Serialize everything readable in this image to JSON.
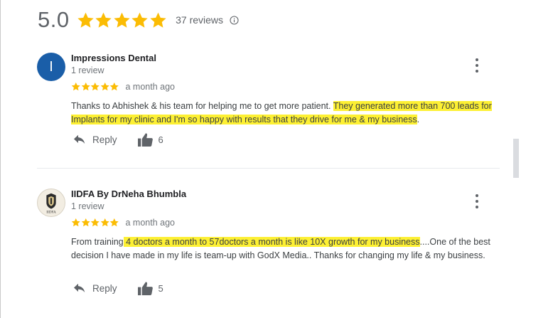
{
  "summary": {
    "rating": "5.0",
    "stars": 5,
    "review_count": "37 reviews",
    "star_color": "#fbbc04"
  },
  "reviews": [
    {
      "reviewer": "Impressions Dental",
      "avatar_letter": "I",
      "avatar_color": "#1a5ea8",
      "meta": "1 review",
      "stars": 5,
      "time": "a month ago",
      "text_plain": "Thanks to Abhishek & his team for helping me to get more patient. ",
      "text_highlight": "They generated more than 700 leads for Implants for my clinic and I'm so happy with results that they drive for me & my business",
      "text_tail": ".",
      "reply_label": "Reply",
      "likes": "6"
    },
    {
      "reviewer": "IIDFA By DrNeha Bhumbla",
      "avatar_text": "IIDFA",
      "meta": "1 review",
      "stars": 5,
      "time": "a month ago",
      "text_plain": "From training",
      "text_highlight": " 4 doctors a month to 57doctors a month is like 10X growth for my business",
      "text_tail": "....One of the best decision I have made in my life is team-up with GodX Media.. Thanks for changing my life & my business.",
      "reply_label": "Reply",
      "likes": "5"
    }
  ],
  "highlight_color": "#fdf033"
}
